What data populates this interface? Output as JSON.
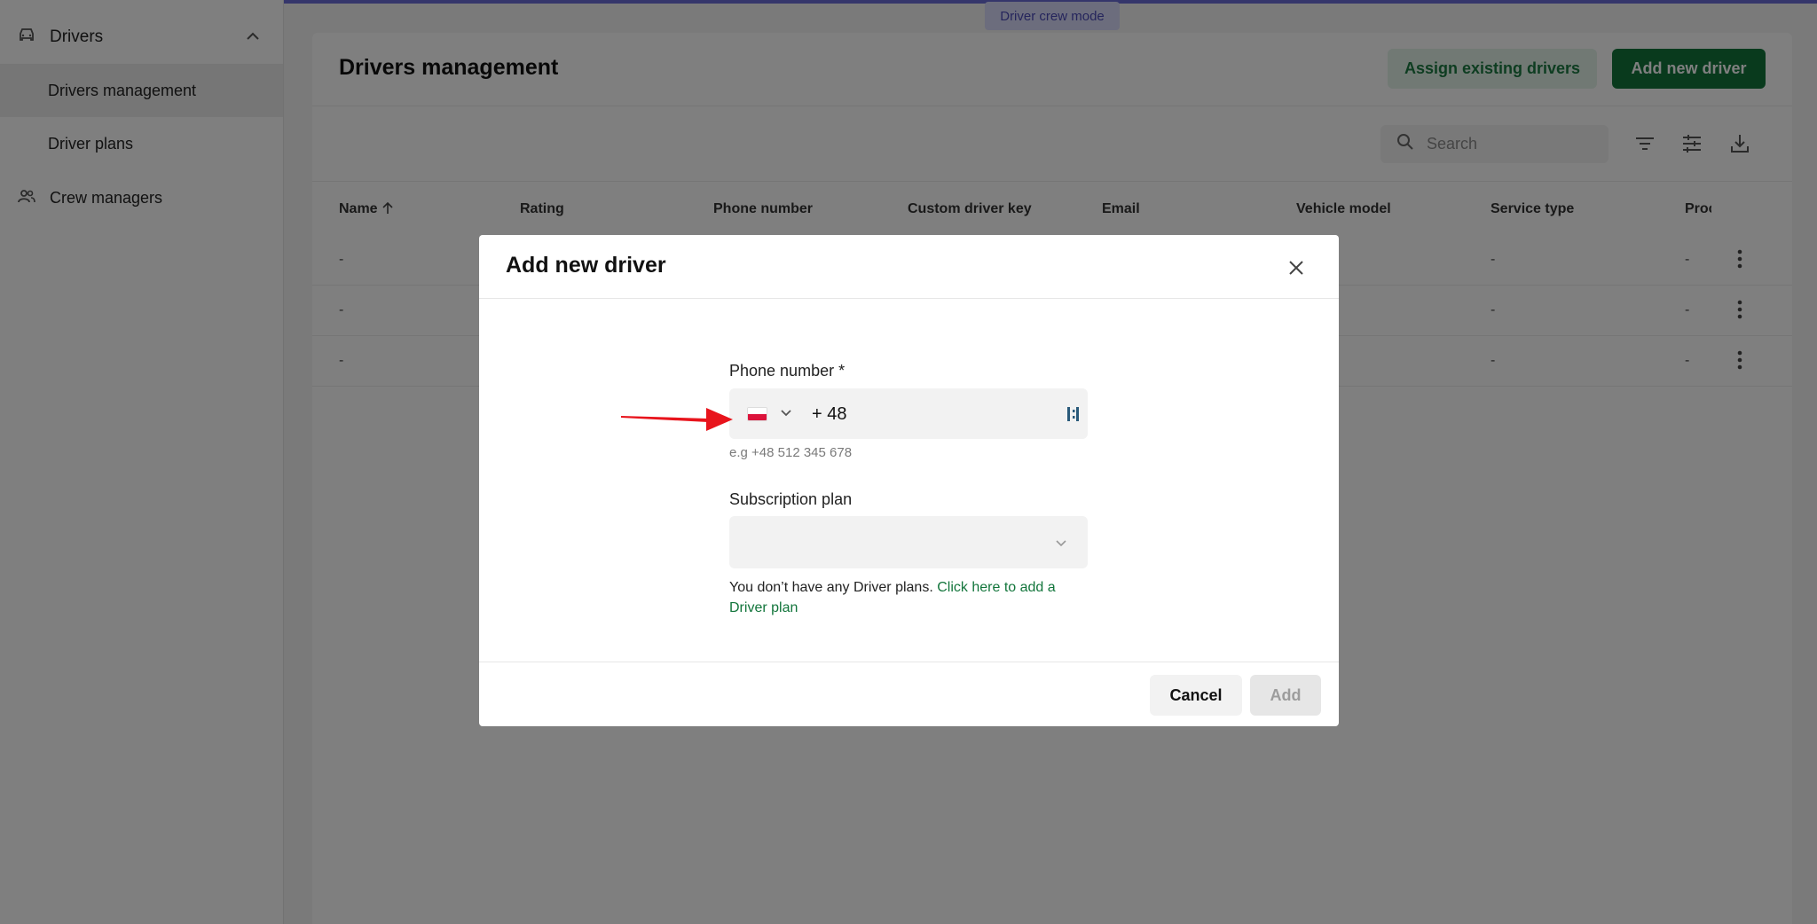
{
  "sidebar": {
    "group_label": "Drivers",
    "items": [
      {
        "label": "Drivers management"
      },
      {
        "label": "Driver plans"
      }
    ],
    "crew_label": "Crew managers"
  },
  "mode_badge": "Driver crew mode",
  "page": {
    "title": "Drivers management",
    "assign_button": "Assign existing drivers",
    "add_button": "Add new driver",
    "search_placeholder": "Search"
  },
  "table": {
    "columns": [
      "Name",
      "Rating",
      "Phone number",
      "Custom driver key",
      "Email",
      "Vehicle model",
      "Service type",
      "Proc"
    ],
    "rows": [
      {
        "name": "-",
        "service_type": "-",
        "proc": "-"
      },
      {
        "name": "-",
        "service_type": "-",
        "proc": "-"
      },
      {
        "name": "-",
        "service_type": "-",
        "proc": "-"
      }
    ]
  },
  "modal": {
    "title": "Add new driver",
    "phone_label": "Phone number *",
    "phone_value": "+ 48",
    "phone_hint": "e.g +48 512 345 678",
    "subscription_label": "Subscription plan",
    "no_plans_text": "You don’t have any Driver plans.",
    "no_plans_link": "Click here to add a Driver plan",
    "cancel_button": "Cancel",
    "submit_button": "Add"
  },
  "colors": {
    "brand_green": "#12753b",
    "annotation_arrow": "#e8141c",
    "mode_badge": "#d9dafb"
  }
}
